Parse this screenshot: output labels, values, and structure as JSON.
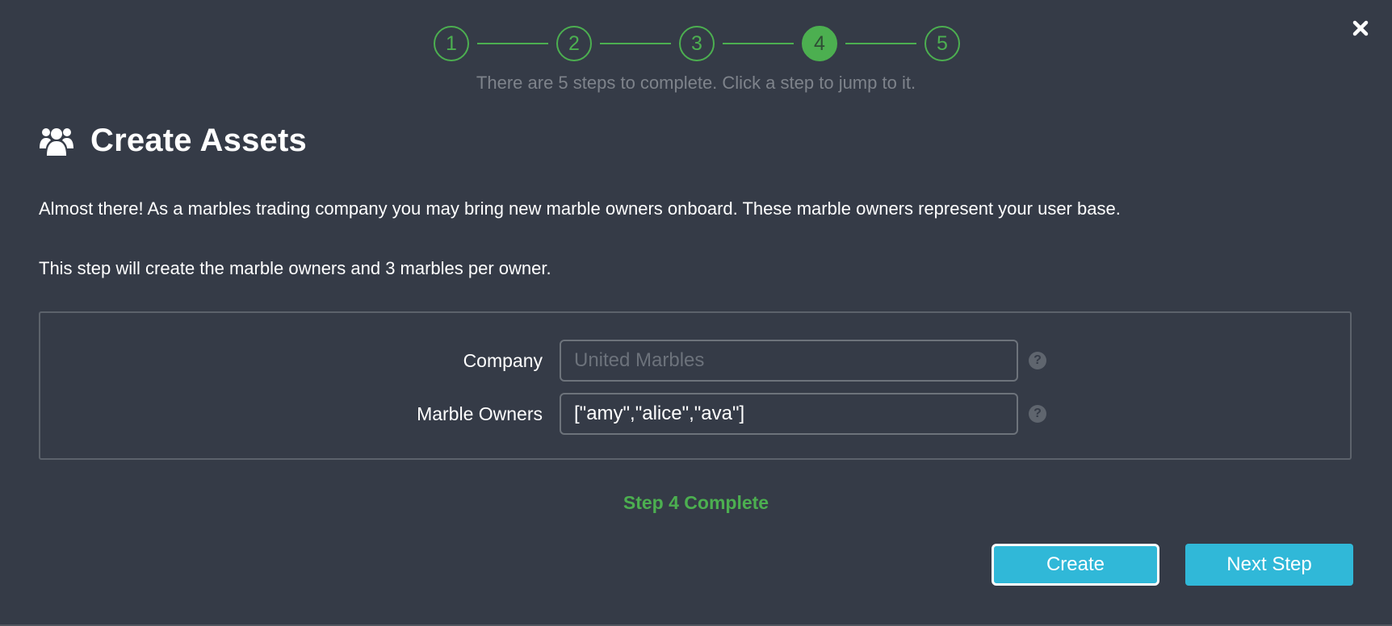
{
  "modal": {
    "close_icon": "close-icon"
  },
  "stepper": {
    "steps": [
      "1",
      "2",
      "3",
      "4",
      "5"
    ],
    "active_step": "4",
    "hint": "There are 5 steps to complete. Click a step to jump to it.",
    "color": "#4caf50"
  },
  "header": {
    "icon": "users-icon",
    "title": "Create Assets"
  },
  "body": {
    "paragraph1": "Almost there! As a marbles trading company you may bring new marble owners onboard. These marble owners represent your user base.",
    "paragraph2": "This step will create the marble owners and 3 marbles per owner."
  },
  "form": {
    "company": {
      "label": "Company",
      "value": "",
      "placeholder": "United Marbles",
      "help_icon": "question-circle-icon"
    },
    "owners": {
      "label": "Marble Owners",
      "value": "[\"amy\",\"alice\",\"ava\"]",
      "placeholder": "",
      "help_icon": "question-circle-icon"
    }
  },
  "status": {
    "text": "Step 4 Complete",
    "color": "#4caf50"
  },
  "actions": {
    "create_label": "Create",
    "next_label": "Next Step",
    "accent": "#30b8d8"
  }
}
